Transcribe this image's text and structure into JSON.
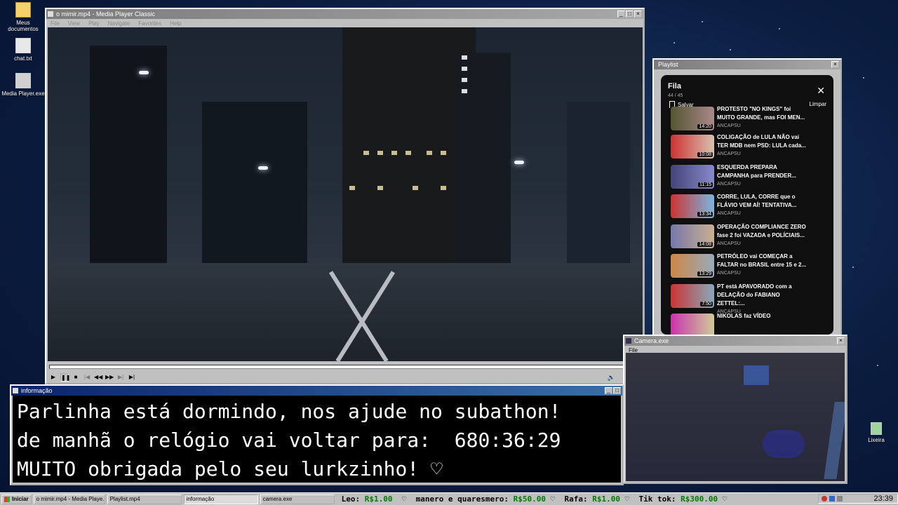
{
  "desktop": {
    "icons": [
      {
        "label": "Meus documentos",
        "icon": "folder-icon"
      },
      {
        "label": "chat.txt",
        "icon": "text-file-icon"
      },
      {
        "label": "Media Player.exe",
        "icon": "media-player-icon"
      },
      {
        "label": "Lixeira",
        "icon": "recycle-bin-icon"
      }
    ]
  },
  "mpc": {
    "title": "o mimir.mp4 - Media Player Classic",
    "menu": [
      "File",
      "View",
      "Play",
      "Navigate",
      "Favorites",
      "Help"
    ]
  },
  "info": {
    "title": "informação",
    "lines": [
      "Parlinha está dormindo, nos ajude no subathon!",
      "de manhã o relógio vai voltar para:  680:36:29",
      "MUITO obrigada pelo seu lurkzinho! ♡"
    ]
  },
  "playlist": {
    "window_title": "Playlist",
    "header": "Fila",
    "count": "44 / 45",
    "save_label": "Salvar",
    "clear_label": "Limpar",
    "items": [
      {
        "title": "PROTESTO \"NO KINGS\" foi MUITO GRANDE, mas FOI MEN...",
        "channel": "ANCAPSU",
        "duration": "14:20"
      },
      {
        "title": "COLIGAÇÃO de LULA NÃO vai TER MDB nem PSD: LULA cada...",
        "channel": "ANCAPSU",
        "duration": "10:08"
      },
      {
        "title": "ESQUERDA PREPARA CAMPANHA para PRENDER...",
        "channel": "ANCAPSU",
        "duration": "11:15"
      },
      {
        "title": "CORRE, LULA, CORRE que o FLÁVIO VEM AÍ! TENTATIVA...",
        "channel": "ANCAPSU",
        "duration": "13:34"
      },
      {
        "title": "OPERAÇÃO COMPLIANCE ZERO fase 2 foi VAZADA e POLÍCIAIS...",
        "channel": "ANCAPSU",
        "duration": "14:08"
      },
      {
        "title": "PETRÓLEO vai COMEÇAR a FALTAR no BRASIL entre 15 e 2...",
        "channel": "ANCAPSU",
        "duration": "13:29"
      },
      {
        "title": "PT está APAVORADO com a DELAÇÃO do FABIANO ZETTEL:...",
        "channel": "ANCAPSU",
        "duration": "7:50"
      },
      {
        "title": "NIKOLAS faz VÍDEO",
        "channel": "",
        "duration": ""
      }
    ]
  },
  "camera": {
    "title": "Camera.exe",
    "menu": "File"
  },
  "taskbar": {
    "start": "Iniciar",
    "tasks": [
      "o mimir.mp4 - Media Playe...",
      "Playlist.mp4",
      "informação",
      "camera.exe"
    ],
    "ticker": [
      {
        "name": "Leo:",
        "amount": "R$1.00"
      },
      {
        "name": "manero e quaresmero:",
        "amount": "R$50.00"
      },
      {
        "name": "Rafa:",
        "amount": "R$1.00"
      },
      {
        "name": "Tik tok:",
        "amount": "R$300.00"
      }
    ],
    "clock": "23:39"
  }
}
